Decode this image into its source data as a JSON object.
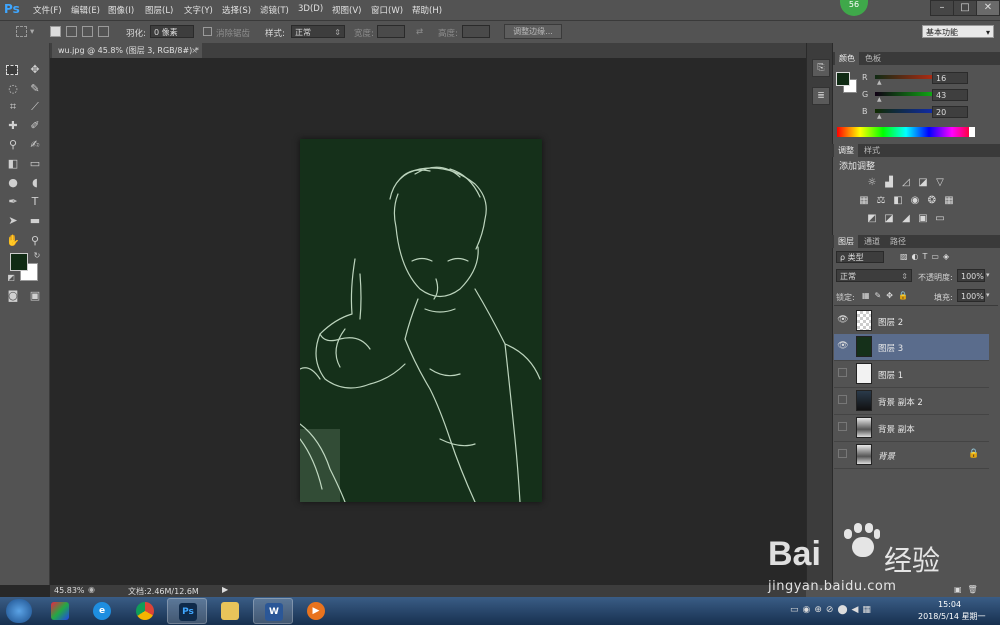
{
  "app": {
    "logo": "Ps",
    "badge": "56"
  },
  "menu": [
    "文件(F)",
    "编辑(E)",
    "图像(I)",
    "图层(L)",
    "文字(Y)",
    "选择(S)",
    "滤镜(T)",
    "3D(D)",
    "视图(V)",
    "窗口(W)",
    "帮助(H)"
  ],
  "window_buttons": {
    "minimize": "–",
    "maximize": "□",
    "close": "✕"
  },
  "options": {
    "feather_label": "羽化:",
    "feather_value": "0 像素",
    "antialias_label": "消除锯齿",
    "style_label": "样式:",
    "style_value": "正常",
    "width_label": "宽度:",
    "height_label": "高度:",
    "refine_button": "调整边缘...",
    "workspace_value": "基本功能"
  },
  "document": {
    "tab_title": "wu.jpg @ 45.8% (图层 3, RGB/8#) *",
    "close": "×"
  },
  "color_panel": {
    "tabs": [
      "颜色",
      "色板"
    ],
    "channels": [
      {
        "label": "R",
        "value": "16",
        "color": "#d03030"
      },
      {
        "label": "G",
        "value": "43",
        "color": "#2e9e3a"
      },
      {
        "label": "B",
        "value": "20",
        "color": "#3050d0"
      }
    ],
    "foreground_color": "#102b14"
  },
  "adjustments_panel": {
    "tabs": [
      "调整",
      "样式"
    ],
    "title": "添加调整"
  },
  "layers_panel": {
    "tabs": [
      "图层",
      "通道",
      "路径"
    ],
    "filter_value": "ρ 类型",
    "blend_mode": "正常",
    "opacity_label": "不透明度:",
    "opacity_value": "100%",
    "lock_label": "锁定:",
    "fill_label": "填充:",
    "fill_value": "100%",
    "layers": [
      {
        "name": "图层 2",
        "visible": true,
        "selected": false,
        "thumb": "transparent"
      },
      {
        "name": "图层 3",
        "visible": true,
        "selected": true,
        "thumb": "dark-green"
      },
      {
        "name": "图层 1",
        "visible": false,
        "selected": false,
        "thumb": "white"
      },
      {
        "name": "背景 副本 2",
        "visible": false,
        "selected": false,
        "thumb": "photo-dark"
      },
      {
        "name": "背景 副本",
        "visible": false,
        "selected": false,
        "thumb": "photo"
      },
      {
        "name": "背景",
        "visible": false,
        "selected": false,
        "thumb": "photo",
        "locked": true
      }
    ]
  },
  "status": {
    "zoom": "45.83%",
    "doc": "文档:2.46M/12.6M"
  },
  "taskbar": {
    "time": "15:04",
    "date": "2018/5/14 星期一",
    "apps": [
      "windows-start",
      "windows-flag",
      "internet-explorer",
      "chrome",
      "photoshop",
      "file-explorer",
      "word",
      "media-player"
    ],
    "ps_label": "Ps",
    "word_label": "W"
  },
  "watermark": {
    "brand": "Bai",
    "brand2": "经验",
    "url": "jingyan.baidu.com"
  }
}
